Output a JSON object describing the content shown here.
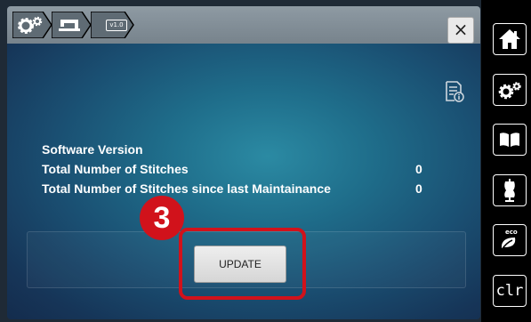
{
  "breadcrumb": {
    "items": [
      {
        "icon": "gears-icon"
      },
      {
        "icon": "sewing-machine-icon"
      },
      {
        "label": "v1.0"
      }
    ]
  },
  "close_label": "×",
  "info": {
    "rows": [
      {
        "label": "Software Version",
        "value": ""
      },
      {
        "label": "Total Number of Stitches",
        "value": "0"
      },
      {
        "label": "Total Number of Stitches since last Maintainance",
        "value": "0"
      }
    ]
  },
  "update_label": "UPDATE",
  "step_number": "3",
  "colors": {
    "highlight": "#d1121b",
    "accent_panel": "#1f6e8b"
  },
  "sidebar": {
    "items": [
      {
        "icon": "home-icon"
      },
      {
        "icon": "settings-gears-icon"
      },
      {
        "icon": "book-icon"
      },
      {
        "icon": "dress-form-icon"
      },
      {
        "icon": "eco-icon",
        "label": "eco"
      },
      {
        "icon": "clr-icon",
        "label": "clr"
      }
    ]
  }
}
